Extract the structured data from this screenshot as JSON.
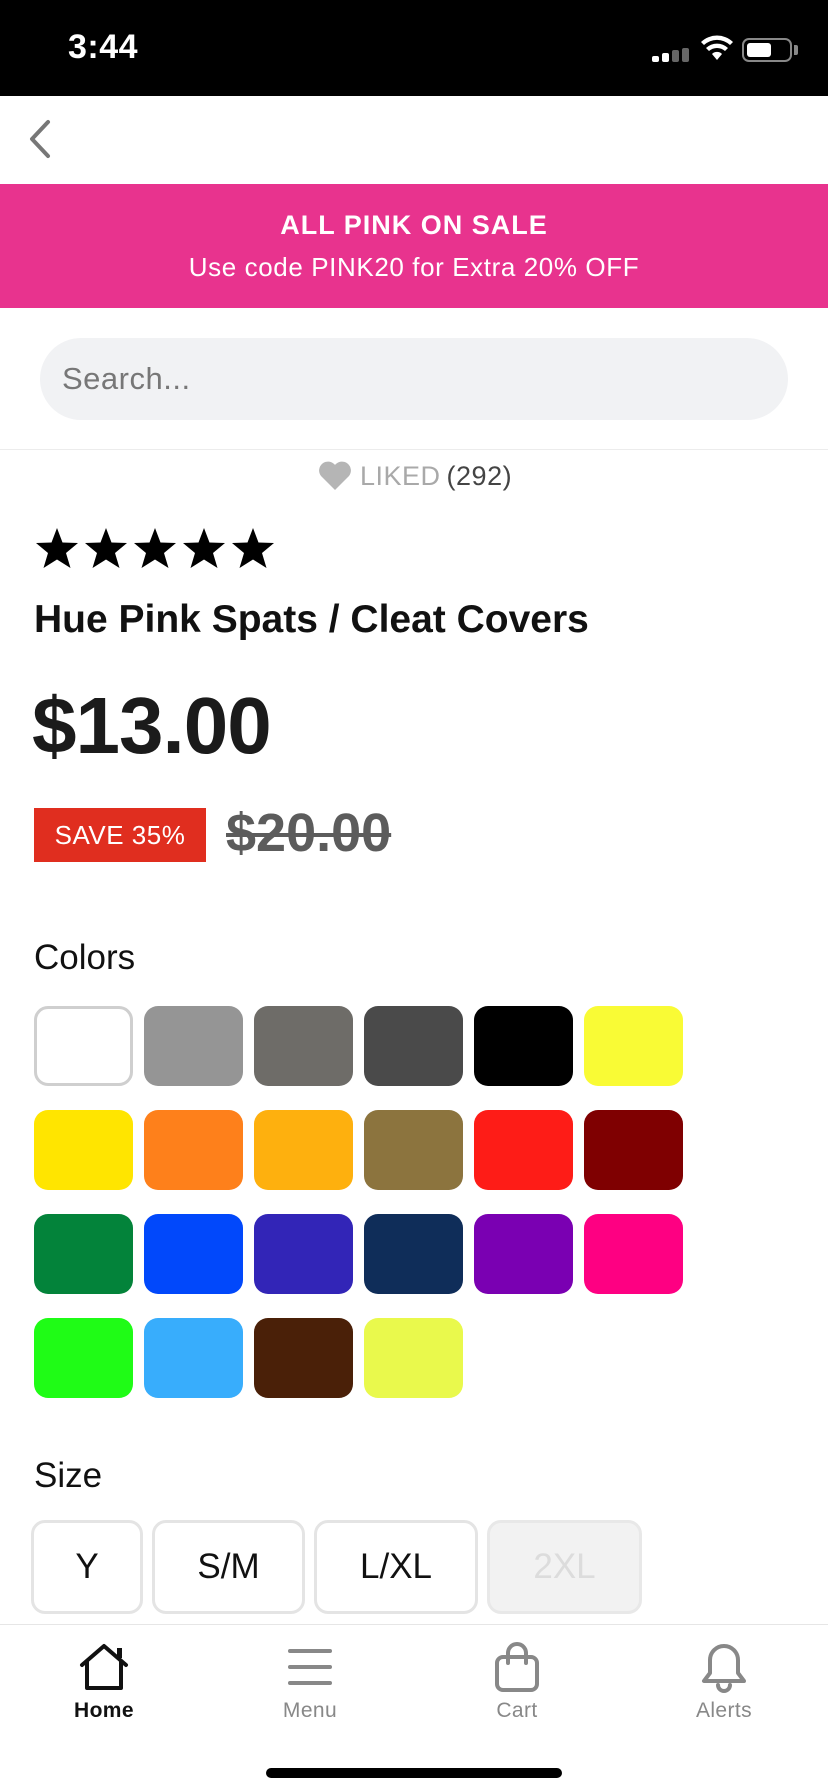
{
  "status_bar": {
    "time": "3:44"
  },
  "promo": {
    "title": "ALL PINK ON SALE",
    "subtitle": "Use code PINK20 for Extra 20% OFF",
    "background_color": "#e8338e"
  },
  "search": {
    "placeholder": "Search...",
    "value": ""
  },
  "liked": {
    "label": "LIKED",
    "count": "(292)"
  },
  "product": {
    "rating": 5,
    "rating_max": 5,
    "title": "Hue Pink Spats / Cleat Covers",
    "price": "$13.00",
    "save_badge": "SAVE 35%",
    "original_price": "$20.00"
  },
  "colors": {
    "label": "Colors",
    "selected_index": 0,
    "swatches": [
      "#ffffff",
      "#959595",
      "#6e6c68",
      "#4a4a4a",
      "#000000",
      "#f9fb35",
      "#ffe500",
      "#fe801b",
      "#feb00e",
      "#8c743e",
      "#fe1c17",
      "#7f0001",
      "#03833a",
      "#0148fb",
      "#3225b7",
      "#0f2d59",
      "#7a00b2",
      "#fe0082",
      "#1ffc16",
      "#38adfc",
      "#4a2008",
      "#e9f94c"
    ]
  },
  "size": {
    "label": "Size",
    "options": [
      {
        "label": "Y",
        "available": true
      },
      {
        "label": "S/M",
        "available": true
      },
      {
        "label": "L/XL",
        "available": true
      },
      {
        "label": "2XL",
        "available": false
      }
    ]
  },
  "tab_bar": {
    "active": "home",
    "tabs": [
      {
        "id": "home",
        "label": "Home",
        "icon": "home-icon"
      },
      {
        "id": "menu",
        "label": "Menu",
        "icon": "menu-icon"
      },
      {
        "id": "cart",
        "label": "Cart",
        "icon": "shopping-bag-icon"
      },
      {
        "id": "alerts",
        "label": "Alerts",
        "icon": "bell-icon"
      }
    ]
  }
}
